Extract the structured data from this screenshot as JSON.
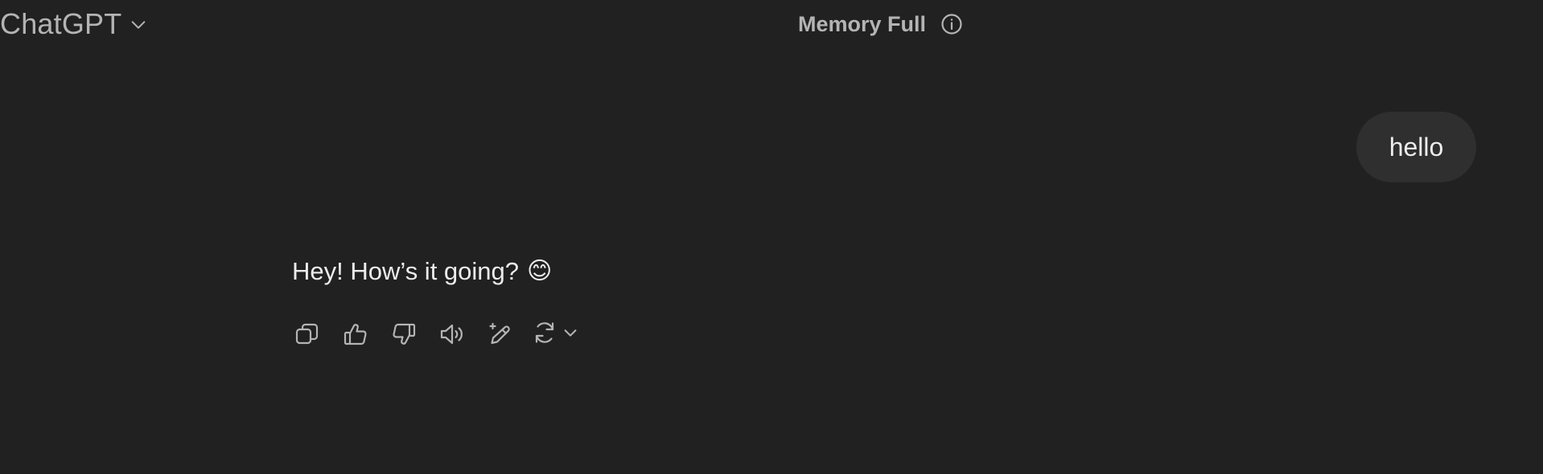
{
  "header": {
    "model_name": "ChatGPT",
    "model_icon": "chevron-down-icon",
    "memory_label": "Memory Full",
    "memory_icon": "info-icon"
  },
  "conversation": {
    "user_message": "hello",
    "assistant_message": "Hey! How’s it going?",
    "assistant_emoji": "😊"
  },
  "actions": [
    {
      "name": "copy",
      "icon": "copy-icon"
    },
    {
      "name": "good-response",
      "icon": "thumbs-up-icon"
    },
    {
      "name": "bad-response",
      "icon": "thumbs-down-icon"
    },
    {
      "name": "read-aloud",
      "icon": "speaker-icon"
    },
    {
      "name": "edit-in-canvas",
      "icon": "pencil-sparkle-icon"
    },
    {
      "name": "regenerate",
      "icon": "refresh-icon"
    }
  ],
  "colors": {
    "background": "#212121",
    "bubble": "#2f2f2f",
    "text": "#ececec",
    "muted": "#b4b4b4"
  }
}
